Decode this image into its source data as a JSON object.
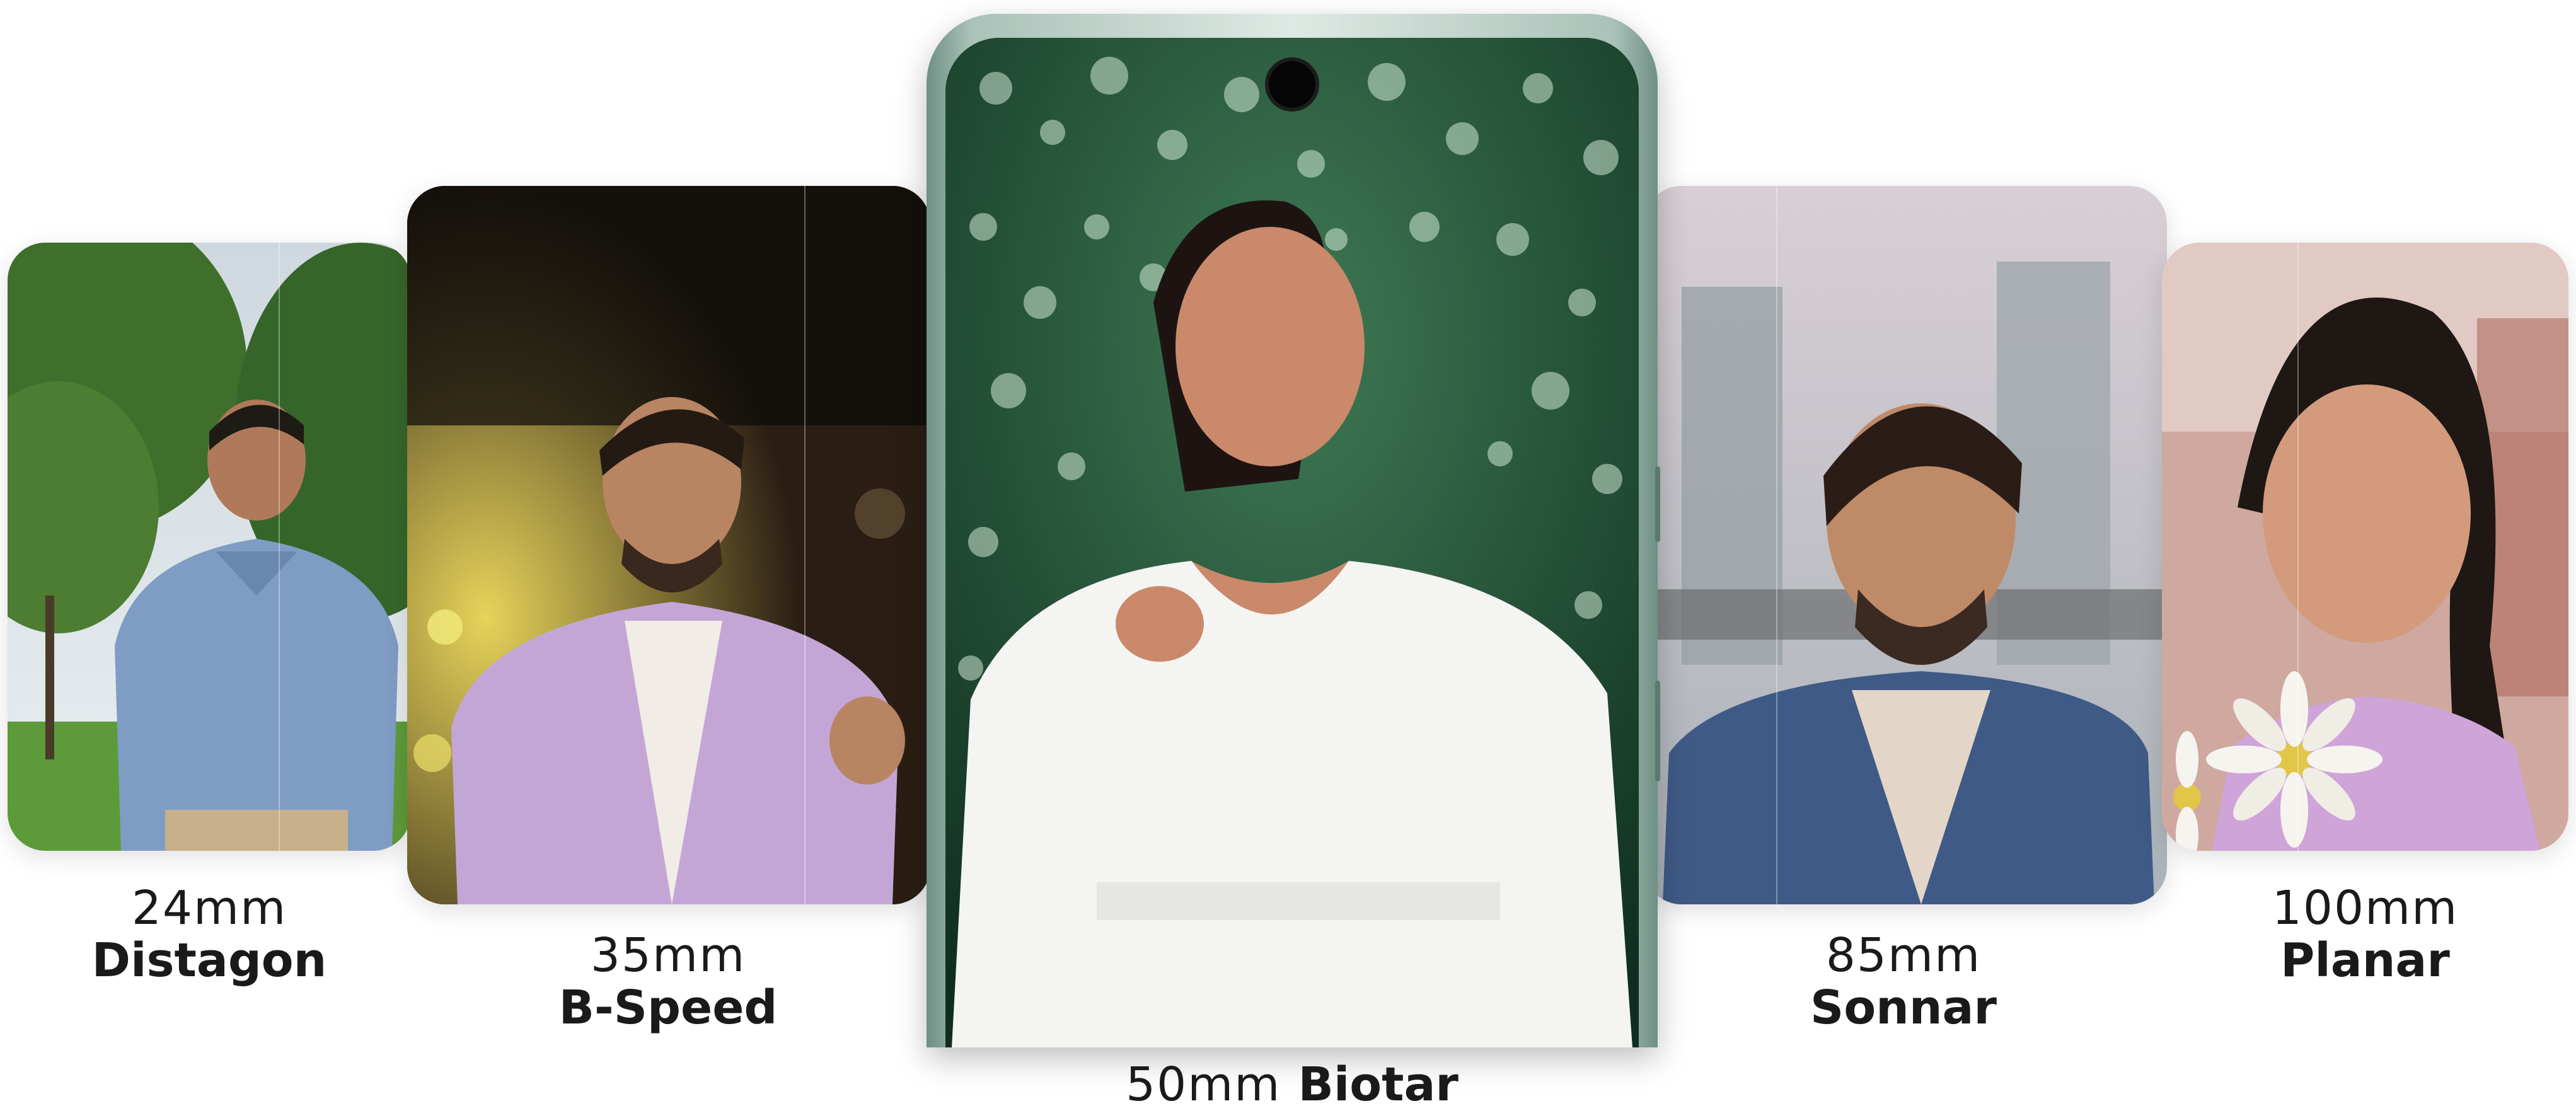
{
  "lenses": [
    {
      "id": "distagon",
      "focal": "24mm",
      "name": "Distagon"
    },
    {
      "id": "bspeed",
      "focal": "35mm",
      "name": "B-Speed"
    },
    {
      "id": "biotar",
      "focal": "50mm",
      "name": "Biotar"
    },
    {
      "id": "sonnar",
      "focal": "85mm",
      "name": "Sonnar"
    },
    {
      "id": "planar",
      "focal": "100mm",
      "name": "Planar"
    }
  ],
  "colors": {
    "phone_frame": "#a9c2b8",
    "text": "#1a1a1a",
    "foliage": "#2f5e2a",
    "bokeh_green": "#1d4a33"
  }
}
